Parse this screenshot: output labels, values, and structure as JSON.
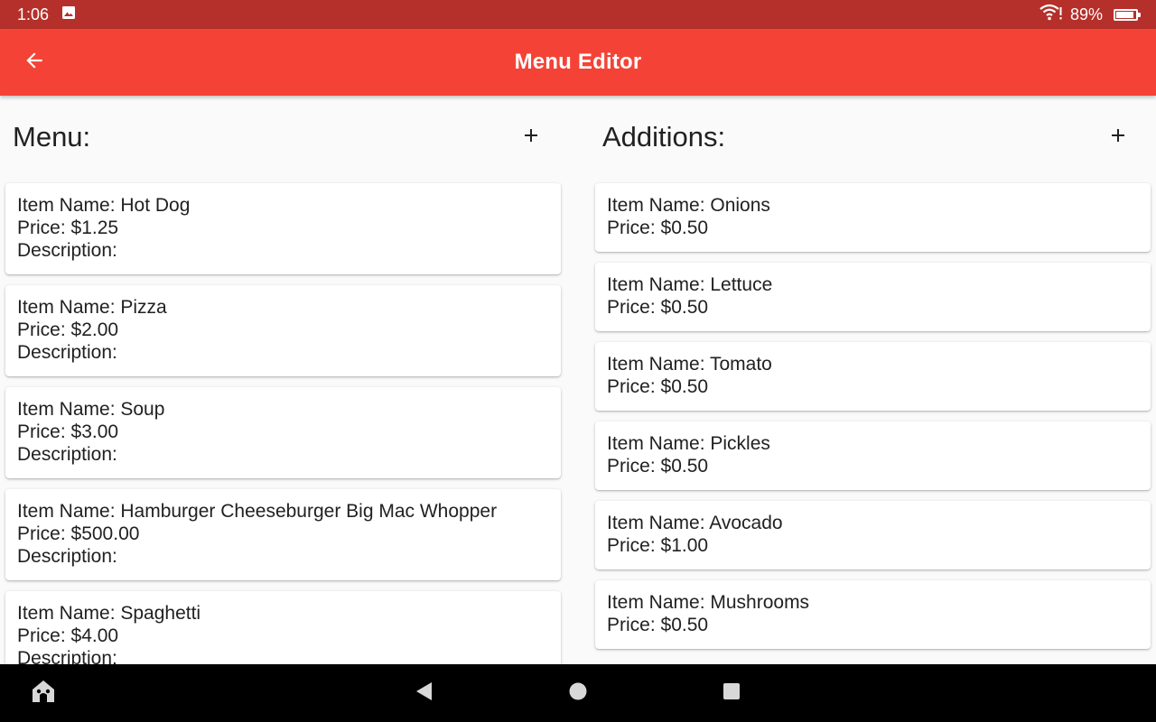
{
  "status_bar": {
    "time": "1:06",
    "battery_percent": "89%",
    "battery_level": 0.89,
    "icons": [
      "gallery-icon",
      "wifi-icon",
      "battery-icon"
    ]
  },
  "app_bar": {
    "title": "Menu Editor",
    "back_icon": "arrow-back-icon"
  },
  "menu": {
    "title": "Menu:",
    "add_icon": "plus-icon",
    "items": [
      {
        "name": "Item Name: Hot Dog",
        "price": "Price: $1.25",
        "description": "Description:"
      },
      {
        "name": "Item Name: Pizza",
        "price": "Price: $2.00",
        "description": "Description:"
      },
      {
        "name": "Item Name: Soup",
        "price": "Price: $3.00",
        "description": "Description:"
      },
      {
        "name": "Item Name: Hamburger Cheeseburger Big Mac Whopper",
        "price": "Price: $500.00",
        "description": "Description:"
      },
      {
        "name": "Item Name: Spaghetti",
        "price": "Price: $4.00",
        "description": "Description:"
      }
    ]
  },
  "additions": {
    "title": "Additions:",
    "add_icon": "plus-icon",
    "items": [
      {
        "name": "Item Name: Onions",
        "price": "Price: $0.50"
      },
      {
        "name": "Item Name: Lettuce",
        "price": "Price: $0.50"
      },
      {
        "name": "Item Name: Tomato",
        "price": "Price: $0.50"
      },
      {
        "name": "Item Name: Pickles",
        "price": "Price: $0.50"
      },
      {
        "name": "Item Name: Avocado",
        "price": "Price: $1.00"
      },
      {
        "name": "Item Name: Mushrooms",
        "price": "Price: $0.50"
      }
    ]
  },
  "nav_bar": {
    "icons": [
      "home-icon",
      "back-triangle-icon",
      "home-circle-icon",
      "recents-square-icon"
    ]
  },
  "colors": {
    "status_bar": "#b5302a",
    "app_bar": "#f44336",
    "background": "#fafafa",
    "nav_bar": "#000000"
  }
}
